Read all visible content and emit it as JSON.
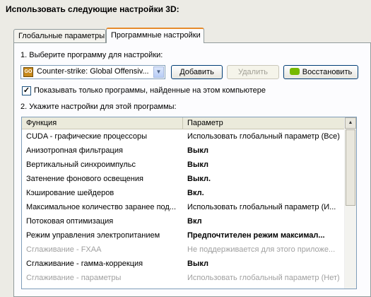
{
  "heading": "Использовать следующие настройки 3D:",
  "tabs": [
    {
      "label": "Глобальные параметры"
    },
    {
      "label": "Программные настройки"
    }
  ],
  "step1_label": "1. Выберите программу для настройки:",
  "program": {
    "icon_text": "GO",
    "selected": "Counter-strike: Global Offensiv..."
  },
  "buttons": {
    "add": "Добавить",
    "delete": "Удалить",
    "restore": "Восстановить"
  },
  "checkbox": {
    "label": "Показывать только программы, найденные на этом компьютере",
    "checked": true
  },
  "step2_label": "2. Укажите настройки для этой программы:",
  "table": {
    "headers": [
      "Функция",
      "Параметр"
    ],
    "rows": [
      {
        "func": "CUDA - графические процессоры",
        "param": "Использовать глобальный параметр (Все)",
        "bold": false,
        "dim": false
      },
      {
        "func": "Анизотропная фильтрация",
        "param": "Выкл",
        "bold": true,
        "dim": false
      },
      {
        "func": "Вертикальный синхроимпульс",
        "param": "Выкл",
        "bold": true,
        "dim": false
      },
      {
        "func": "Затенение фонового освещения",
        "param": "Выкл.",
        "bold": true,
        "dim": false
      },
      {
        "func": "Кэширование шейдеров",
        "param": "Вкл.",
        "bold": true,
        "dim": false
      },
      {
        "func": "Максимальное количество заранее под...",
        "param": "Использовать глобальный параметр (И...",
        "bold": false,
        "dim": false
      },
      {
        "func": "Потоковая оптимизация",
        "param": "Вкл",
        "bold": true,
        "dim": false
      },
      {
        "func": "Режим управления электропитанием",
        "param": "Предпочтителен режим максимал...",
        "bold": true,
        "dim": false
      },
      {
        "func": "Сглаживание - FXAA",
        "param": "Не поддерживается для этого приложе...",
        "bold": false,
        "dim": true
      },
      {
        "func": "Сглаживание - гамма-коррекция",
        "param": "Выкл",
        "bold": true,
        "dim": false
      },
      {
        "func": "Сглаживание - параметры",
        "param": "Использовать глобальный параметр (Нет)",
        "bold": false,
        "dim": true
      }
    ]
  }
}
